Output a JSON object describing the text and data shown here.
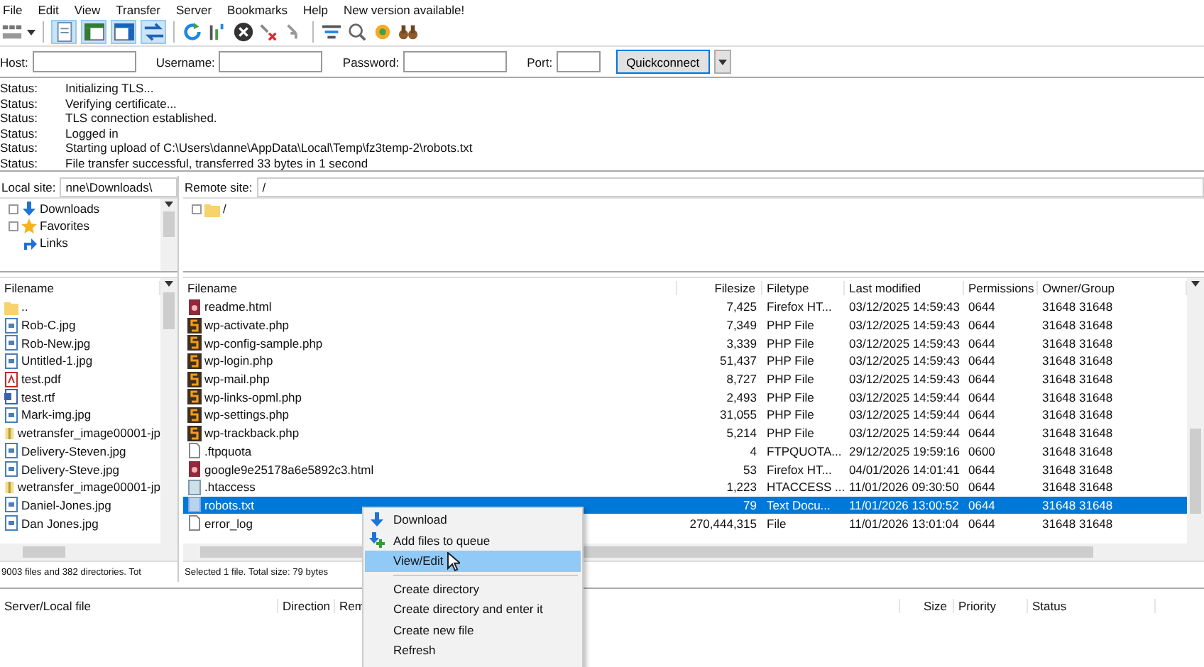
{
  "menu_bar": [
    "File",
    "Edit",
    "View",
    "Transfer",
    "Server",
    "Bookmarks",
    "Help",
    "New version available!"
  ],
  "toolbar": {
    "site_manager": {
      "kind": "site-manager"
    },
    "view_toggles": [
      {
        "kind": "message-log",
        "on": true
      },
      {
        "kind": "local-tree",
        "on": true
      },
      {
        "kind": "remote-tree",
        "on": true
      },
      {
        "kind": "transfer-queue",
        "on": true
      }
    ],
    "actions": [
      {
        "kind": "refresh"
      },
      {
        "kind": "process-queue"
      },
      {
        "kind": "cancel"
      },
      {
        "kind": "disconnect"
      },
      {
        "kind": "reconnect"
      }
    ],
    "tools": [
      {
        "kind": "filter"
      },
      {
        "kind": "search"
      },
      {
        "kind": "sync"
      },
      {
        "kind": "binoculars"
      }
    ]
  },
  "quickconnect": {
    "fields": [
      {
        "label": "Host:"
      },
      {
        "label": "Username:"
      },
      {
        "label": "Password:"
      },
      {
        "label": "Port:"
      }
    ],
    "button": "Quickconnect"
  },
  "message_log": [
    {
      "label": "Status:",
      "message": "Initializing TLS..."
    },
    {
      "label": "Status:",
      "message": "Verifying certificate..."
    },
    {
      "label": "Status:",
      "message": "TLS connection established."
    },
    {
      "label": "Status:",
      "message": "Logged in"
    },
    {
      "label": "Status:",
      "message": "Starting upload of C:\\Users\\danne\\AppData\\Local\\Temp\\fz3temp-2\\robots.txt"
    },
    {
      "label": "Status:",
      "message": "File transfer successful, transferred 33 bytes in 1 second"
    }
  ],
  "local": {
    "site_label": "Local site:",
    "path": "nne\\Downloads\\",
    "tree": [
      {
        "label": "Downloads",
        "kind": "download",
        "has_children": true
      },
      {
        "label": "Favorites",
        "kind": "star",
        "has_children": true
      },
      {
        "label": "Links",
        "kind": "link",
        "has_children": false
      }
    ],
    "columns": [
      "Filename"
    ],
    "files": [
      {
        "name": "..",
        "kind": "folder"
      },
      {
        "name": "Rob-C.jpg",
        "kind": "image"
      },
      {
        "name": "Rob-New.jpg",
        "kind": "image"
      },
      {
        "name": "Untitled-1.jpg",
        "kind": "image"
      },
      {
        "name": "test.pdf",
        "kind": "pdf"
      },
      {
        "name": "test.rtf",
        "kind": "rtf"
      },
      {
        "name": "Mark-img.jpg",
        "kind": "image"
      },
      {
        "name": "wetransfer_image00001-jp",
        "kind": "archive"
      },
      {
        "name": "Delivery-Steven.jpg",
        "kind": "image"
      },
      {
        "name": "Delivery-Steve.jpg",
        "kind": "image"
      },
      {
        "name": "wetransfer_image00001-jp",
        "kind": "archive"
      },
      {
        "name": "Daniel-Jones.jpg",
        "kind": "image"
      },
      {
        "name": "Dan Jones.jpg",
        "kind": "image"
      }
    ],
    "status": "9003 files and 382 directories. Tot"
  },
  "remote": {
    "site_label": "Remote site:",
    "path": "/",
    "tree": [
      {
        "label": "/",
        "kind": "folder",
        "has_children": true
      }
    ],
    "columns": [
      "Filename",
      "Filesize",
      "Filetype",
      "Last modified",
      "Permissions",
      "Owner/Group"
    ],
    "files": [
      {
        "name": "readme.html",
        "kind": "html",
        "size": "7,425",
        "type": "Firefox HT...",
        "modified": "03/12/2025 14:59:43",
        "permissions": "0644",
        "owner": "31648 31648",
        "selected": false
      },
      {
        "name": "wp-activate.php",
        "kind": "php",
        "size": "7,349",
        "type": "PHP File",
        "modified": "03/12/2025 14:59:43",
        "permissions": "0644",
        "owner": "31648 31648",
        "selected": false
      },
      {
        "name": "wp-config-sample.php",
        "kind": "php",
        "size": "3,339",
        "type": "PHP File",
        "modified": "03/12/2025 14:59:43",
        "permissions": "0644",
        "owner": "31648 31648",
        "selected": false
      },
      {
        "name": "wp-login.php",
        "kind": "php",
        "size": "51,437",
        "type": "PHP File",
        "modified": "03/12/2025 14:59:43",
        "permissions": "0644",
        "owner": "31648 31648",
        "selected": false
      },
      {
        "name": "wp-mail.php",
        "kind": "php",
        "size": "8,727",
        "type": "PHP File",
        "modified": "03/12/2025 14:59:43",
        "permissions": "0644",
        "owner": "31648 31648",
        "selected": false
      },
      {
        "name": "wp-links-opml.php",
        "kind": "php",
        "size": "2,493",
        "type": "PHP File",
        "modified": "03/12/2025 14:59:44",
        "permissions": "0644",
        "owner": "31648 31648",
        "selected": false
      },
      {
        "name": "wp-settings.php",
        "kind": "php",
        "size": "31,055",
        "type": "PHP File",
        "modified": "03/12/2025 14:59:44",
        "permissions": "0644",
        "owner": "31648 31648",
        "selected": false
      },
      {
        "name": "wp-trackback.php",
        "kind": "php",
        "size": "5,214",
        "type": "PHP File",
        "modified": "03/12/2025 14:59:44",
        "permissions": "0644",
        "owner": "31648 31648",
        "selected": false
      },
      {
        "name": ".ftpquota",
        "kind": "blank",
        "size": "4",
        "type": "FTPQUOTA...",
        "modified": "29/12/2025 19:59:16",
        "permissions": "0600",
        "owner": "31648 31648",
        "selected": false
      },
      {
        "name": "google9e25178a6e5892c3.html",
        "kind": "html",
        "size": "53",
        "type": "Firefox HT...",
        "modified": "04/01/2026 14:01:41",
        "permissions": "0644",
        "owner": "31648 31648",
        "selected": false
      },
      {
        "name": ".htaccess",
        "kind": "config",
        "size": "1,223",
        "type": "HTACCESS ...",
        "modified": "11/01/2026 09:30:50",
        "permissions": "0644",
        "owner": "31648 31648",
        "selected": false
      },
      {
        "name": "robots.txt",
        "kind": "text",
        "size": "79",
        "type": "Text Docu...",
        "modified": "11/01/2026 13:00:52",
        "permissions": "0644",
        "owner": "31648 31648",
        "selected": true
      },
      {
        "name": "error_log",
        "kind": "blank",
        "size": "270,444,315",
        "type": "File",
        "modified": "11/01/2026 13:01:04",
        "permissions": "0644",
        "owner": "31648 31648",
        "selected": false
      }
    ],
    "status": "Selected 1 file. Total size: 79 bytes"
  },
  "queue": {
    "columns": [
      "Server/Local file",
      "Direction",
      "Rem",
      "Size",
      "Priority",
      "Status"
    ]
  },
  "context_menu": [
    [
      {
        "label": "Download",
        "kind": "download",
        "selected": false
      },
      {
        "label": "Add files to queue",
        "kind": "add-queue",
        "selected": false
      },
      {
        "label": "View/Edit",
        "kind": "plain",
        "selected": true
      }
    ],
    [
      {
        "label": "Create directory",
        "kind": "plain",
        "selected": false
      },
      {
        "label": "Create directory and enter it",
        "kind": "plain",
        "selected": false
      },
      {
        "label": "Create new file",
        "kind": "plain",
        "selected": false
      },
      {
        "label": "Refresh",
        "kind": "plain",
        "selected": false
      }
    ]
  ]
}
